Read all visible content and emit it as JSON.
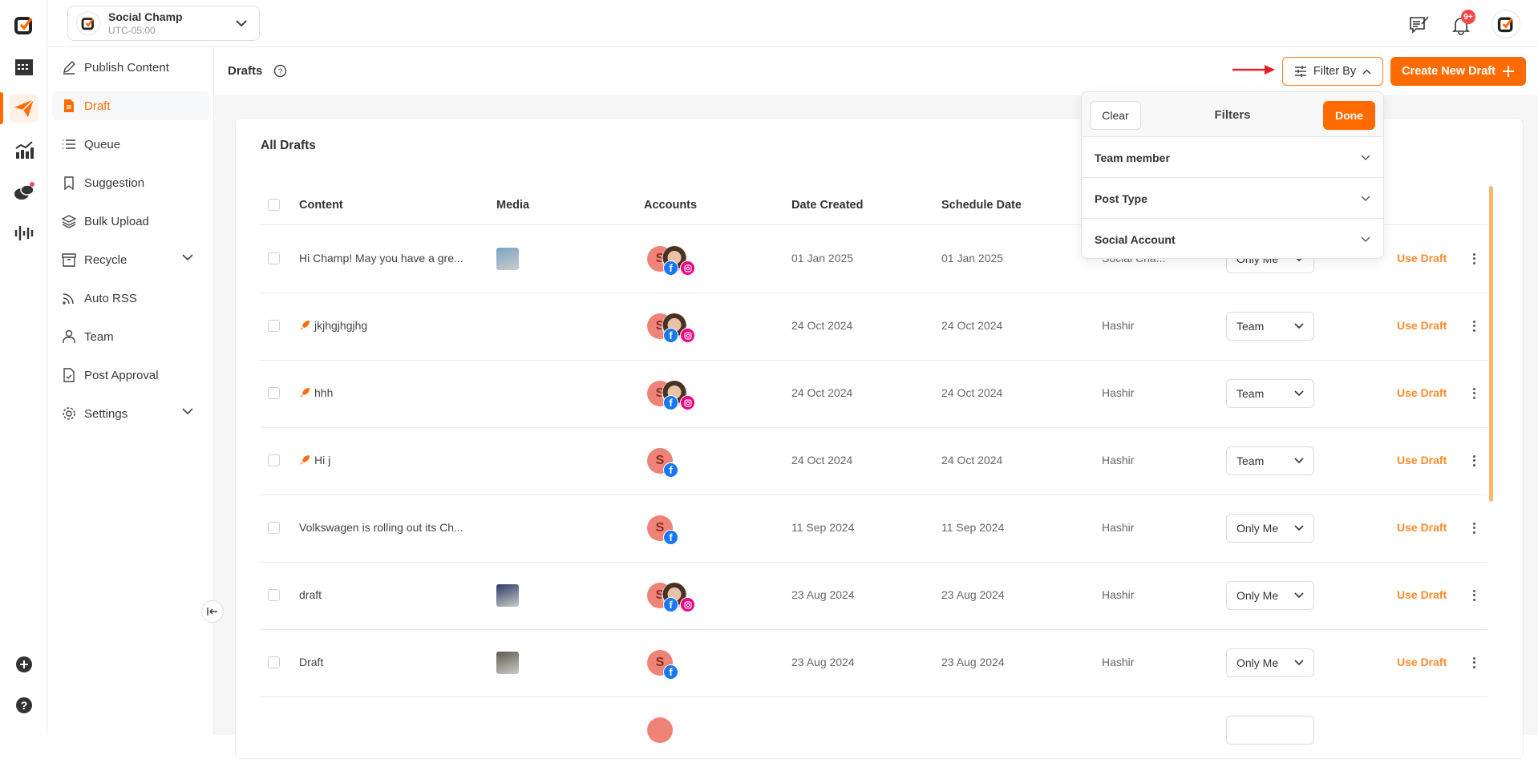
{
  "account": {
    "name": "Social Champ",
    "timezone": "UTC-05:00"
  },
  "topbar": {
    "notification_badge": "9+"
  },
  "sidebar": {
    "items": [
      {
        "label": "Publish Content",
        "icon": "pencil-icon"
      },
      {
        "label": "Draft",
        "icon": "document-icon",
        "active": true
      },
      {
        "label": "Queue",
        "icon": "list-icon"
      },
      {
        "label": "Suggestion",
        "icon": "bookmark-icon"
      },
      {
        "label": "Bulk Upload",
        "icon": "layers-icon"
      },
      {
        "label": "Recycle",
        "icon": "archive-icon",
        "expandable": true
      },
      {
        "label": "Auto RSS",
        "icon": "rss-icon"
      },
      {
        "label": "Team",
        "icon": "user-icon"
      },
      {
        "label": "Post Approval",
        "icon": "file-check-icon"
      },
      {
        "label": "Settings",
        "icon": "gear-icon",
        "expandable": true
      }
    ]
  },
  "header": {
    "title": "Drafts",
    "filter_label": "Filter By",
    "create_label": "Create New Draft"
  },
  "filters": {
    "title": "Filters",
    "clear": "Clear",
    "done": "Done",
    "sections": [
      "Team member",
      "Post Type",
      "Social Account"
    ]
  },
  "table": {
    "title": "All Drafts",
    "columns": [
      "Content",
      "Media",
      "Accounts",
      "Date Created",
      "Schedule Date"
    ],
    "action_label": "Use Draft",
    "rows": [
      {
        "content": "Hi Champ! May you have a gre...",
        "media": "#7aa3c2",
        "accounts": [
          "facebook",
          "instagram"
        ],
        "created": "01 Jan 2025",
        "scheduled": "01 Jan 2025",
        "by": "Social Cha...",
        "visibility": "Only Me"
      },
      {
        "content": "jkjhgjhgjhg",
        "rocket": true,
        "media": null,
        "accounts": [
          "facebook",
          "instagram"
        ],
        "created": "24 Oct 2024",
        "scheduled": "24 Oct 2024",
        "by": "Hashir",
        "visibility": "Team"
      },
      {
        "content": "hhh",
        "rocket": true,
        "media": null,
        "accounts": [
          "facebook",
          "instagram"
        ],
        "created": "24 Oct 2024",
        "scheduled": "24 Oct 2024",
        "by": "Hashir",
        "visibility": "Team"
      },
      {
        "content": "Hi j",
        "rocket": true,
        "media": null,
        "accounts": [
          "facebook"
        ],
        "created": "24 Oct 2024",
        "scheduled": "24 Oct 2024",
        "by": "Hashir",
        "visibility": "Team"
      },
      {
        "content": "Volkswagen is rolling out its Ch...",
        "media": null,
        "accounts": [
          "facebook"
        ],
        "created": "11 Sep 2024",
        "scheduled": "11 Sep 2024",
        "by": "Hashir",
        "visibility": "Only Me"
      },
      {
        "content": "draft",
        "media": "#2c3a66",
        "accounts": [
          "facebook",
          "instagram"
        ],
        "created": "23 Aug 2024",
        "scheduled": "23 Aug 2024",
        "by": "Hashir",
        "visibility": "Only Me"
      },
      {
        "content": "Draft",
        "media": "#5e5a4c",
        "accounts": [
          "facebook"
        ],
        "created": "23 Aug 2024",
        "scheduled": "23 Aug 2024",
        "by": "Hashir",
        "visibility": "Only Me"
      }
    ]
  },
  "colors": {
    "accent": "#ff6b00",
    "link": "#ff8a2b",
    "facebook": "#1877f2",
    "instagram": "#f0047f",
    "avatar": "#f08378"
  }
}
